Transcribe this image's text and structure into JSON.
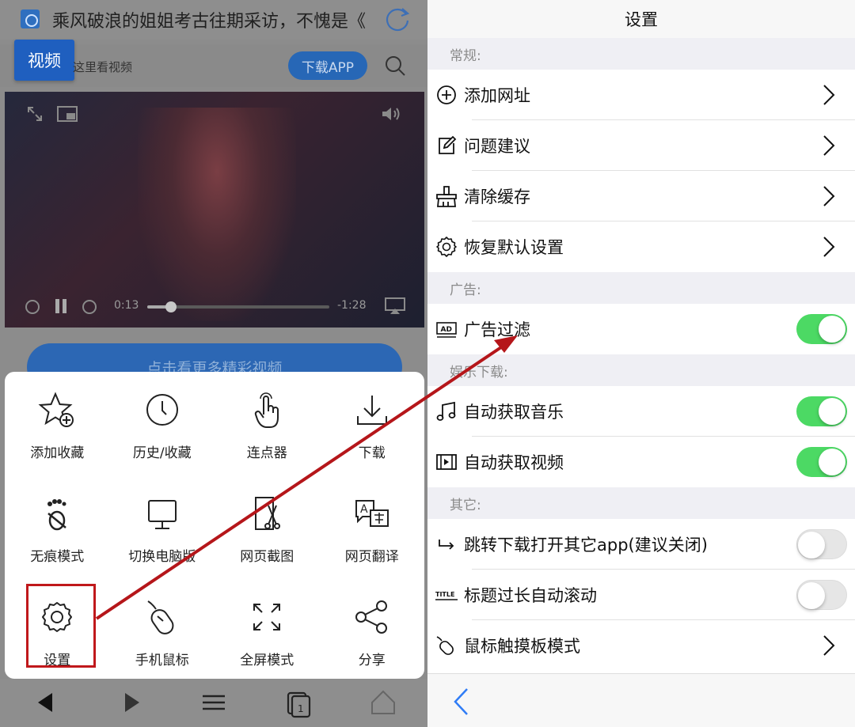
{
  "left": {
    "news_title": "乘风破浪的姐姐考古往期采访，不愧是《",
    "video_badge": "视频",
    "video_hint": "这里看视频",
    "download_app": "下载APP",
    "player": {
      "elapsed": "0:13",
      "remaining": "-1:28",
      "progress": 0.13
    },
    "more_videos": "点击看更多精彩视频",
    "menu": [
      {
        "label": "添加收藏",
        "icon": "star-plus-icon"
      },
      {
        "label": "历史/收藏",
        "icon": "clock-icon"
      },
      {
        "label": "连点器",
        "icon": "tap-hand-icon"
      },
      {
        "label": "下载",
        "icon": "download-icon"
      },
      {
        "label": "无痕模式",
        "icon": "incognito-footprint-icon"
      },
      {
        "label": "切换电脑版",
        "icon": "desktop-icon"
      },
      {
        "label": "网页截图",
        "icon": "screenshot-scissors-icon"
      },
      {
        "label": "网页翻译",
        "icon": "translate-icon"
      },
      {
        "label": "设置",
        "icon": "gear-icon"
      },
      {
        "label": "手机鼠标",
        "icon": "mouse-icon"
      },
      {
        "label": "全屏模式",
        "icon": "fullscreen-icon"
      },
      {
        "label": "分享",
        "icon": "share-icon"
      }
    ]
  },
  "right": {
    "title": "设置",
    "sections": {
      "general": "常规:",
      "ads": "广告:",
      "entertainment": "娱乐下载:",
      "other": "其它:"
    },
    "rows": {
      "add_url": "添加网址",
      "feedback": "问题建议",
      "clear_cache": "清除缓存",
      "restore_defaults": "恢复默认设置",
      "ad_filter": "广告过滤",
      "auto_music": "自动获取音乐",
      "auto_video": "自动获取视频",
      "open_other_app": "跳转下载打开其它app(建议关闭)",
      "title_scroll": "标题过长自动滚动",
      "touchpad_mode": "鼠标触摸板模式"
    },
    "toggles": {
      "ad_filter": true,
      "auto_music": true,
      "auto_video": true,
      "open_other_app": false,
      "title_scroll": false
    },
    "icon_text": {
      "ad": "AD",
      "title": "TITLE"
    }
  },
  "colors": {
    "accent_green": "#4cd964",
    "highlight_red": "#c0181b",
    "link_blue": "#2f7cf6"
  }
}
